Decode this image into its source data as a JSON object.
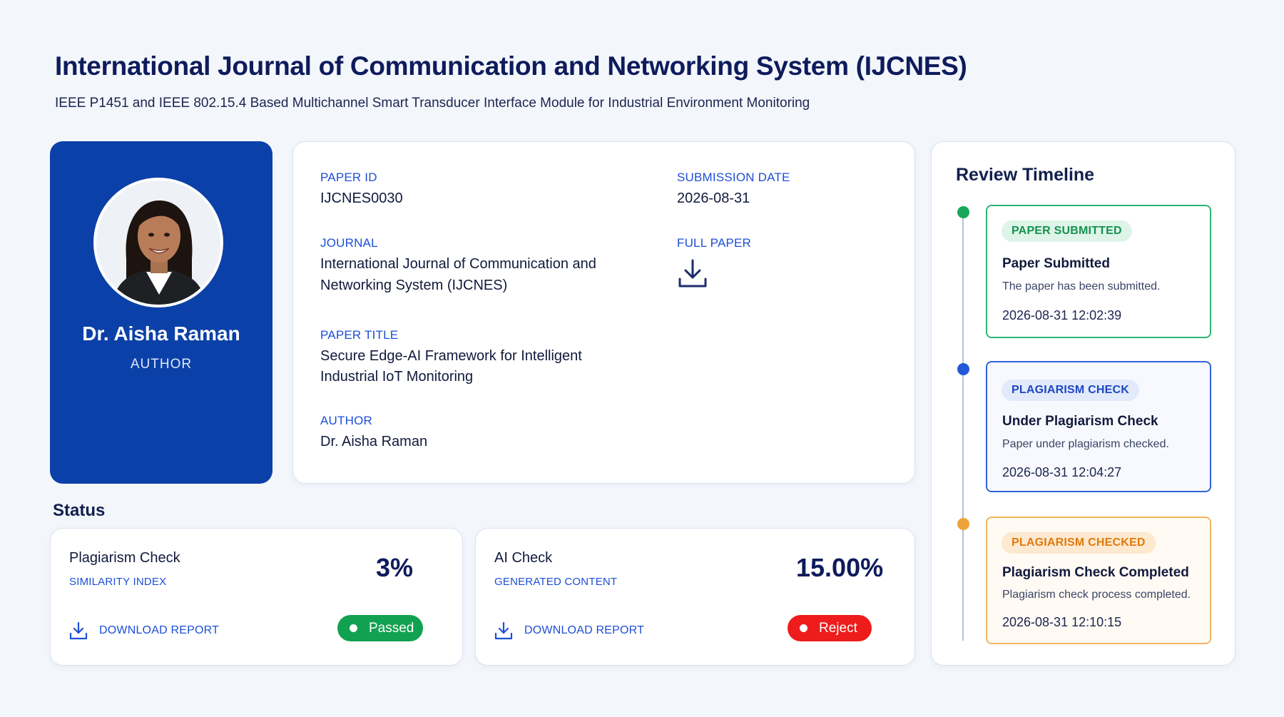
{
  "header": {
    "title": "International Journal of Communication and Networking System (IJCNES)",
    "subtitle": "IEEE P1451 and IEEE 802.15.4 Based Multichannel Smart Transducer Interface Module for Industrial Environment Monitoring"
  },
  "profile": {
    "name": "Dr. Aisha Raman",
    "role": "AUTHOR",
    "card_color": "#0b40a8"
  },
  "info": {
    "paper_id_label": "PAPER ID",
    "paper_id": "IJCNES0030",
    "submission_date_label": "SUBMISSION DATE",
    "submission_date": "2026-08-31",
    "journal_label": "JOURNAL",
    "journal_line1": "International Journal of Communication and",
    "journal_line2": "Networking System (IJCNES)",
    "full_paper_label": "FULL PAPER",
    "full_paper_icon": "download-icon",
    "paper_title_label": "PAPER TITLE",
    "paper_title_line1": "Secure Edge-AI Framework for Intelligent",
    "paper_title_line2": "Industrial IoT Monitoring",
    "author_label": "AUTHOR",
    "author": "Dr. Aisha Raman"
  },
  "status": {
    "heading": "Status",
    "plagiarism": {
      "title": "Plagiarism Check",
      "subtitle": "SIMILARITY INDEX",
      "value": "3%",
      "download_label": "DOWNLOAD REPORT",
      "result": "Passed",
      "result_color": "#12a150"
    },
    "ai": {
      "title": "AI Check",
      "subtitle": "GENERATED CONTENT",
      "value": "15.00%",
      "download_label": "DOWNLOAD REPORT",
      "result": "Reject",
      "result_color": "#ee1c1c"
    }
  },
  "timeline": {
    "title": "Review Timeline",
    "events": [
      {
        "badge": "PAPER SUBMITTED",
        "heading": "Paper Submitted",
        "description": "The paper has been submitted.",
        "time": "2026-08-31 12:02:39",
        "color": "#19a85b"
      },
      {
        "badge": "PLAGIARISM CHECK",
        "heading": "Under Plagiarism Check",
        "description": "Paper under plagiarism checked.",
        "time": "2026-08-31 12:04:27",
        "color": "#2359d8"
      },
      {
        "badge": "PLAGIARISM CHECKED",
        "heading": "Plagiarism Check Completed",
        "description": "Plagiarism check process completed.",
        "time": "2026-08-31 12:10:15",
        "color": "#f0a23a"
      }
    ]
  }
}
